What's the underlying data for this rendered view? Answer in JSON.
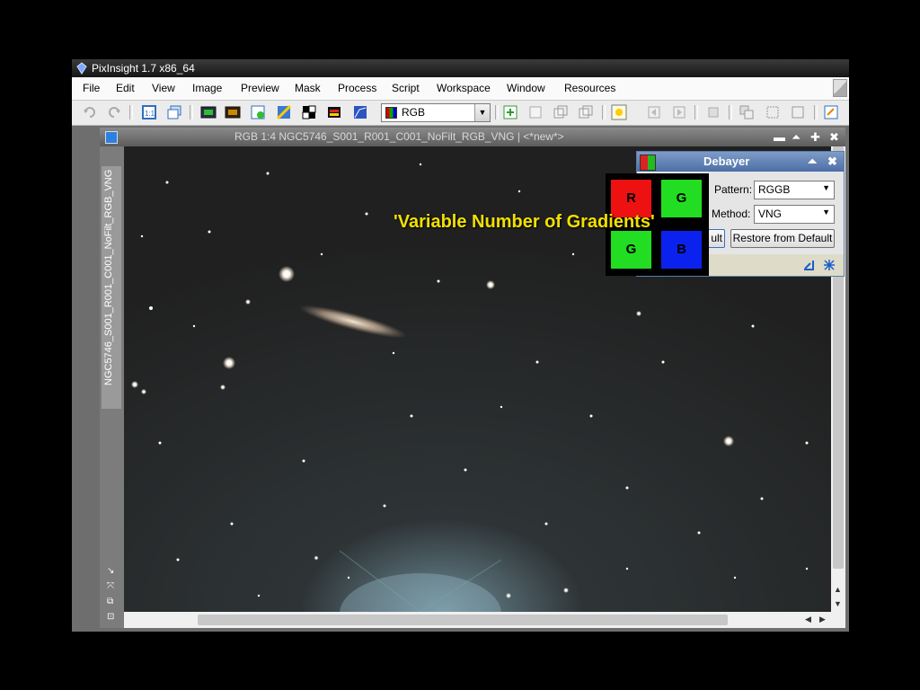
{
  "app": {
    "title": "PixInsight 1.7 x86_64"
  },
  "menu": [
    "File",
    "Edit",
    "View",
    "Image",
    "Preview",
    "Mask",
    "Process",
    "Script",
    "Workspace",
    "Window",
    "Resources"
  ],
  "toolbar": {
    "channel_combo": "RGB"
  },
  "image_window": {
    "title": "RGB 1:4 NGC5746_S001_R001_C001_NoFilt_RGB_VNG | <*new*>",
    "side_label": "NGC5746_S001_R001_C001_NoFilt_RGB_VNG"
  },
  "debayer": {
    "title": "Debayer",
    "pattern_label": "Pattern:",
    "pattern_value": "RGGB",
    "method_label": "Method:",
    "method_value": "VNG",
    "default_button_partial": "ult",
    "restore_button": "Restore from Default"
  },
  "bayer_matrix": [
    {
      "label": "R",
      "color": "#ee1111"
    },
    {
      "label": "G",
      "color": "#22dd22"
    },
    {
      "label": "G",
      "color": "#22dd22"
    },
    {
      "label": "B",
      "color": "#0b22ee"
    }
  ],
  "overlay_caption": "'Variable Number of Gradients'",
  "colors": {
    "title_bar": "#161616",
    "debayer_title": "#5a7db0",
    "accent_blue": "#2d7fe0"
  }
}
